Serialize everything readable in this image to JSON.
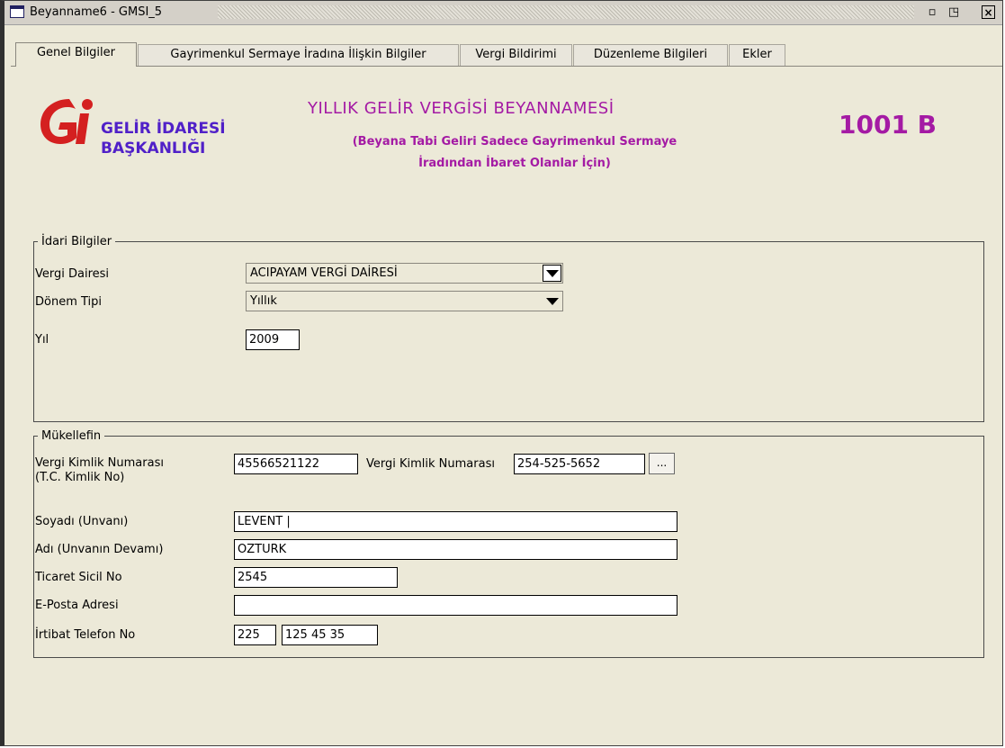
{
  "window": {
    "title": "Beyanname6 - GMSI_5",
    "controls": {
      "restore": "▫",
      "maximize": "◳",
      "close": "×"
    }
  },
  "tabs": [
    {
      "label": "Genel Bilgiler",
      "active": true
    },
    {
      "label": "Gayrimenkul Sermaye İradına İlişkin Bilgiler",
      "active": false
    },
    {
      "label": "Vergi Bildirimi",
      "active": false
    },
    {
      "label": "Düzenleme Bilgileri",
      "active": false
    },
    {
      "label": "Ekler",
      "active": false
    }
  ],
  "header": {
    "org_line1": "GELİR İDARESİ",
    "org_line2": "BAŞKANLIĞI",
    "form_title": "YILLIK GELİR VERGİSİ BEYANNAMESİ",
    "form_subtitle_line1": "(Beyana Tabi Geliri Sadece Gayrimenkul Sermaye",
    "form_subtitle_line2": "İradından İbaret Olanlar İçin)",
    "form_code": "1001 B",
    "accent_color": "#a41aa4",
    "org_color": "#5020c8",
    "logo_color": "#d42020"
  },
  "idari": {
    "legend": "İdari Bilgiler",
    "vergi_dairesi_label": "Vergi Dairesi",
    "vergi_dairesi_value": "ACIPAYAM VERGİ DAİRESİ",
    "donem_tipi_label": "Dönem Tipi",
    "donem_tipi_value": "Yıllık",
    "yil_label": "Yıl",
    "yil_value": "2009"
  },
  "mukellef": {
    "legend": "Mükellefin",
    "tckn_label_line1": "Vergi Kimlik Numarası",
    "tckn_label_line2": "(T.C. Kimlik No)",
    "tckn_value": "45566521122",
    "vkn_label": "Vergi Kimlik Numarası",
    "vkn_value": "254-525-5652",
    "vkn_lookup_label": "...",
    "soyadi_label": "Soyadı (Unvanı)",
    "soyadi_value": "LEVENT |",
    "adi_label": "Adı (Unvanın Devamı)",
    "adi_value": "ÖZTÜRK",
    "ticaret_label": "Ticaret Sicil No",
    "ticaret_value": "2545",
    "eposta_label": "E-Posta Adresi",
    "eposta_value": "",
    "telefon_label": "İrtibat Telefon No",
    "telefon_kod": "225",
    "telefon_no": "125 45 35"
  }
}
